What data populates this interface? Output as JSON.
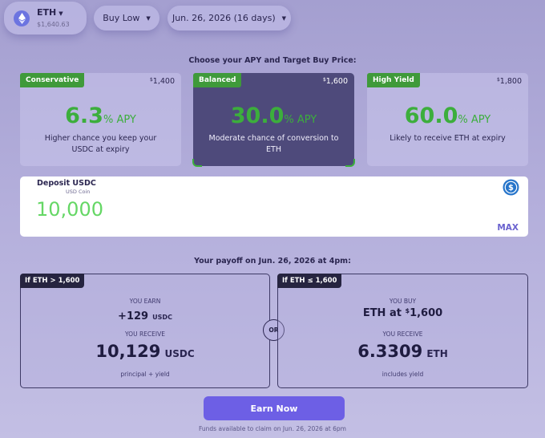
{
  "header": {
    "asset_symbol": "ETH",
    "asset_price": "$1,640.63",
    "strategy": "Buy Low",
    "expiry": "Jun. 26, 2026 (16 days)"
  },
  "tiers_title": "Choose your APY and Target Buy Price:",
  "tiers": [
    {
      "tag": "Conservative",
      "target_sym": "$",
      "target": "1,400",
      "apy_num": "6.3",
      "apy_unit": "% APY",
      "desc": "Higher chance you keep your USDC at expiry"
    },
    {
      "tag": "Balanced",
      "target_sym": "$",
      "target": "1,600",
      "apy_num": "30.0",
      "apy_unit": "% APY",
      "desc": "Moderate chance of conversion to ETH"
    },
    {
      "tag": "High Yield",
      "target_sym": "$",
      "target": "1,800",
      "apy_num": "60.0",
      "apy_unit": "% APY",
      "desc": "Likely to receive ETH at expiry"
    }
  ],
  "deposit": {
    "label": "Deposit USDC",
    "sublabel": "USD Coin",
    "amount": "10,000",
    "max_label": "MAX",
    "icon": "usdc-icon"
  },
  "payoff_title": "Your payoff on Jun. 26, 2026 at 4pm:",
  "payoff_left": {
    "tag": "If ETH > 1,600",
    "cap1": "YOU EARN",
    "val1": "+129",
    "val1_unit": "USDC",
    "cap2": "YOU RECEIVE",
    "val2": "10,129",
    "val2_unit": "USDC",
    "note": "principal + yield"
  },
  "or_label": "OR",
  "payoff_right": {
    "tag": "If ETH ≤ 1,600",
    "cap1": "YOU BUY",
    "val1_pre": "ETH at ",
    "val1_sym": "$",
    "val1": "1,600",
    "cap2": "YOU RECEIVE",
    "val2": "6.3309",
    "val2_unit": "ETH",
    "note": "includes yield"
  },
  "cta": "Earn Now",
  "footnote": "Funds available to claim on Jun. 26, 2026 at 6pm",
  "colors": {
    "accent": "#6d5fe5",
    "apy_green": "#3cae3c",
    "tag_green": "#3f9a3a",
    "selected_bg": "#4e4a7b",
    "usdc_blue": "#2775ca"
  }
}
